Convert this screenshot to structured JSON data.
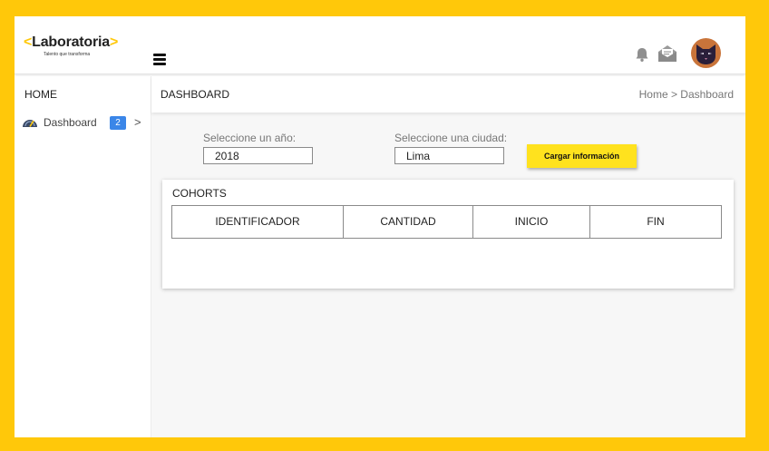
{
  "header": {
    "logo_text": "Laboratoria",
    "logo_bracket_left": "<",
    "logo_bracket_right": ">",
    "logo_tagline": "Talento que transforma",
    "icons": [
      "menu-icon",
      "bell-icon",
      "mail-icon",
      "cat-avatar"
    ]
  },
  "sidebar": {
    "home_label": "HOME",
    "items": [
      {
        "label": "Dashboard",
        "badge": "2",
        "chevron": ">",
        "icon": "gauge-icon"
      }
    ]
  },
  "main": {
    "title": "DASHBOARD",
    "breadcrumb": "Home > Dashboard"
  },
  "filters": {
    "year_label": "Seleccione un año:",
    "year_value": "2018",
    "city_label": "Seleccione una ciudad:",
    "city_value": "Lima",
    "load_button": "Cargar información"
  },
  "cohorts": {
    "title": "COHORTS",
    "columns": [
      "IDENTIFICADOR",
      "CANTIDAD",
      "INICIO",
      "FIN"
    ],
    "rows": []
  },
  "colors": {
    "frame_background": "#FFC80A",
    "button": "#FFE21E",
    "badge": "#3B86E8",
    "avatar": "#C9743A"
  }
}
